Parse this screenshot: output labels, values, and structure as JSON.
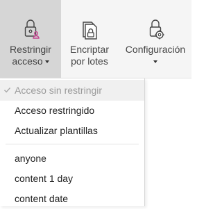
{
  "ribbon": {
    "buttons": [
      {
        "line1": "Restringir",
        "line2": "acceso",
        "icon": "lock-user-icon",
        "has_dropdown": true
      },
      {
        "line1": "Encriptar",
        "line2": "por lotes",
        "icon": "batch-lock-icon",
        "has_dropdown": false
      },
      {
        "line1": "Configuración",
        "line2": "",
        "icon": "lock-gear-icon",
        "has_dropdown": true
      }
    ],
    "accent_color": "#c2478f"
  },
  "dropdown": {
    "items": [
      {
        "label": "Acceso sin restringir",
        "state": "checked-disabled"
      },
      {
        "label": "Acceso restringido",
        "state": "normal"
      },
      {
        "label": "Actualizar plantillas",
        "state": "normal"
      },
      {
        "label": "anyone",
        "state": "normal"
      },
      {
        "label": "content 1 day",
        "state": "normal"
      },
      {
        "label": "content date",
        "state": "normal"
      }
    ]
  }
}
